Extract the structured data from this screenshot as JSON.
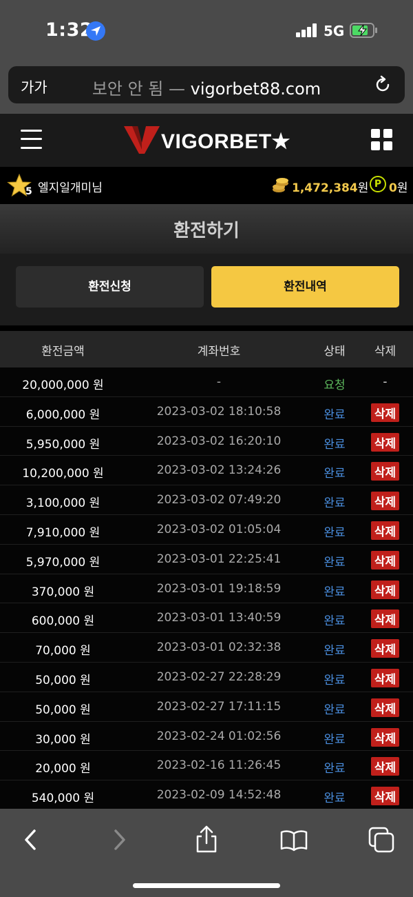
{
  "status_bar": {
    "time": "1:32",
    "network": "5G"
  },
  "browser": {
    "text_size": "가가",
    "url_insecure": "보안 안 됨 —",
    "url_domain": "vigorbet88.com"
  },
  "site": {
    "logo": "VIGORBET★"
  },
  "user": {
    "level": "5",
    "name": "엘지일개미님",
    "balance": "1,472,384",
    "balance_unit": "원",
    "points": "0",
    "points_unit": "원",
    "point_symbol": "P"
  },
  "page": {
    "title": "환전하기",
    "tab_request": "환전신청",
    "tab_history": "환전내역"
  },
  "table": {
    "headers": {
      "amount": "환전금액",
      "account": "계좌번호",
      "status": "상태",
      "delete": "삭제"
    },
    "rows": [
      {
        "amount": "20,000,000 원",
        "account": "-",
        "status": "요청",
        "delete": "-"
      },
      {
        "amount": "6,000,000 원",
        "account": "2023-03-02 18:10:58",
        "status": "완료",
        "delete": "삭제"
      },
      {
        "amount": "5,950,000 원",
        "account": "2023-03-02 16:20:10",
        "status": "완료",
        "delete": "삭제"
      },
      {
        "amount": "10,200,000 원",
        "account": "2023-03-02 13:24:26",
        "status": "완료",
        "delete": "삭제"
      },
      {
        "amount": "3,100,000 원",
        "account": "2023-03-02 07:49:20",
        "status": "완료",
        "delete": "삭제"
      },
      {
        "amount": "7,910,000 원",
        "account": "2023-03-02 01:05:04",
        "status": "완료",
        "delete": "삭제"
      },
      {
        "amount": "5,970,000 원",
        "account": "2023-03-01 22:25:41",
        "status": "완료",
        "delete": "삭제"
      },
      {
        "amount": "370,000 원",
        "account": "2023-03-01 19:18:59",
        "status": "완료",
        "delete": "삭제"
      },
      {
        "amount": "600,000 원",
        "account": "2023-03-01 13:40:59",
        "status": "완료",
        "delete": "삭제"
      },
      {
        "amount": "70,000 원",
        "account": "2023-03-01 02:32:38",
        "status": "완료",
        "delete": "삭제"
      },
      {
        "amount": "50,000 원",
        "account": "2023-02-27 22:28:29",
        "status": "완료",
        "delete": "삭제"
      },
      {
        "amount": "50,000 원",
        "account": "2023-02-27 17:11:15",
        "status": "완료",
        "delete": "삭제"
      },
      {
        "amount": "30,000 원",
        "account": "2023-02-24 01:02:56",
        "status": "완료",
        "delete": "삭제"
      },
      {
        "amount": "20,000 원",
        "account": "2023-02-16 11:26:45",
        "status": "완료",
        "delete": "삭제"
      },
      {
        "amount": "540,000 원",
        "account": "2023-02-09 14:52:48",
        "status": "완료",
        "delete": "삭제"
      }
    ]
  },
  "colors": {
    "accent": "#f5c842",
    "delete": "#c0201b",
    "status_done": "#4a8fe0",
    "status_pending": "#5cb85c"
  }
}
